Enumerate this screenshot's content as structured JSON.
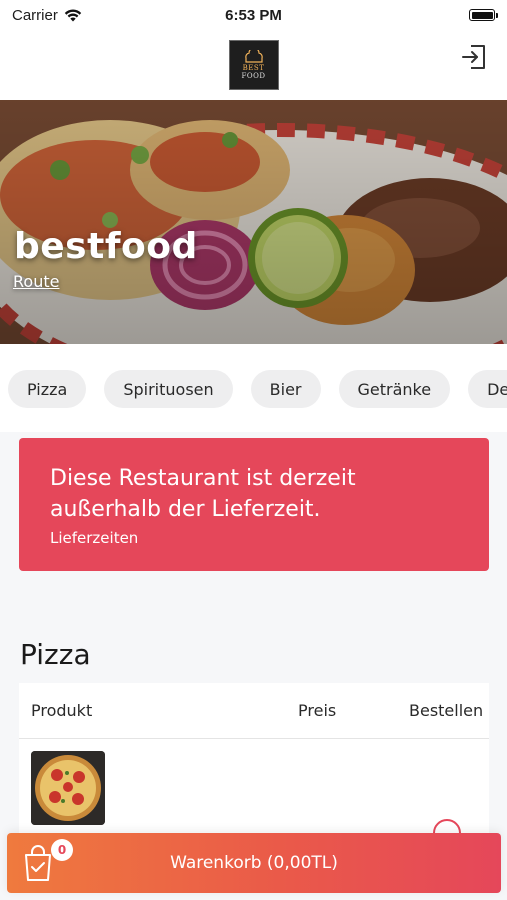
{
  "status_bar": {
    "carrier": "Carrier",
    "time": "6:53 PM"
  },
  "nav": {
    "logo_text_top": "BEST",
    "logo_text_bottom": "FOOD",
    "logout_icon": "logout-icon"
  },
  "hero": {
    "title": "bestfood",
    "link_label": "Route"
  },
  "categories": [
    "Pizza",
    "Spirituosen",
    "Bier",
    "Getränke",
    "De"
  ],
  "alert": {
    "message": "Diese Restaurant ist derzeit außerhalb der Lieferzeit.",
    "link_label": "Lieferzeiten"
  },
  "section": {
    "title": "Pizza",
    "columns": [
      "Produkt",
      "Preis",
      "Bestellen"
    ]
  },
  "cart": {
    "label": "Warenkorb (0,00TL)",
    "badge_count": "0"
  },
  "colors": {
    "accent": "#e5475a",
    "cart_gradient_start": "#ef7a3e"
  }
}
